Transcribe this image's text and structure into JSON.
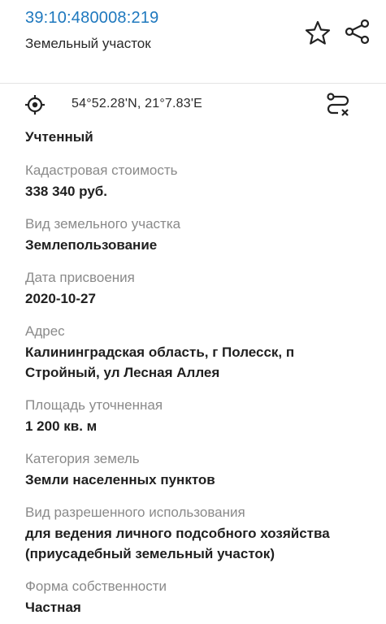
{
  "header": {
    "cadastral_number": "39:10:480008:219",
    "subtitle": "Земельный участок",
    "favorite_icon": "star-outline-icon",
    "share_icon": "share-icon"
  },
  "coordinates": {
    "text": "54°52.28'N, 21°7.83'E",
    "locate_icon": "crosshair-target-icon",
    "route_icon": "route-icon"
  },
  "status": "Учтенный",
  "fields": [
    {
      "label": "Кадастровая стоимость",
      "value": "338 340 руб."
    },
    {
      "label": "Вид земельного участка",
      "value": "Землепользование"
    },
    {
      "label": "Дата присвоения",
      "value": "2020-10-27"
    },
    {
      "label": "Адрес",
      "value": "Калининградская область, г Полесск, п Стройный, ул Лесная Аллея"
    },
    {
      "label": "Площадь уточненная",
      "value": "1 200 кв. м"
    },
    {
      "label": "Категория земель",
      "value": "Земли населенных пунктов"
    },
    {
      "label": "Вид разрешенного использования",
      "value": "для ведения личного подсобного хозяйства (приусадебный земельный участок)"
    },
    {
      "label": "Форма собственности",
      "value": "Частная"
    }
  ],
  "colors": {
    "accent": "#1e78be",
    "label_gray": "#8a8a8a",
    "text_dark": "#1f1f1f"
  }
}
